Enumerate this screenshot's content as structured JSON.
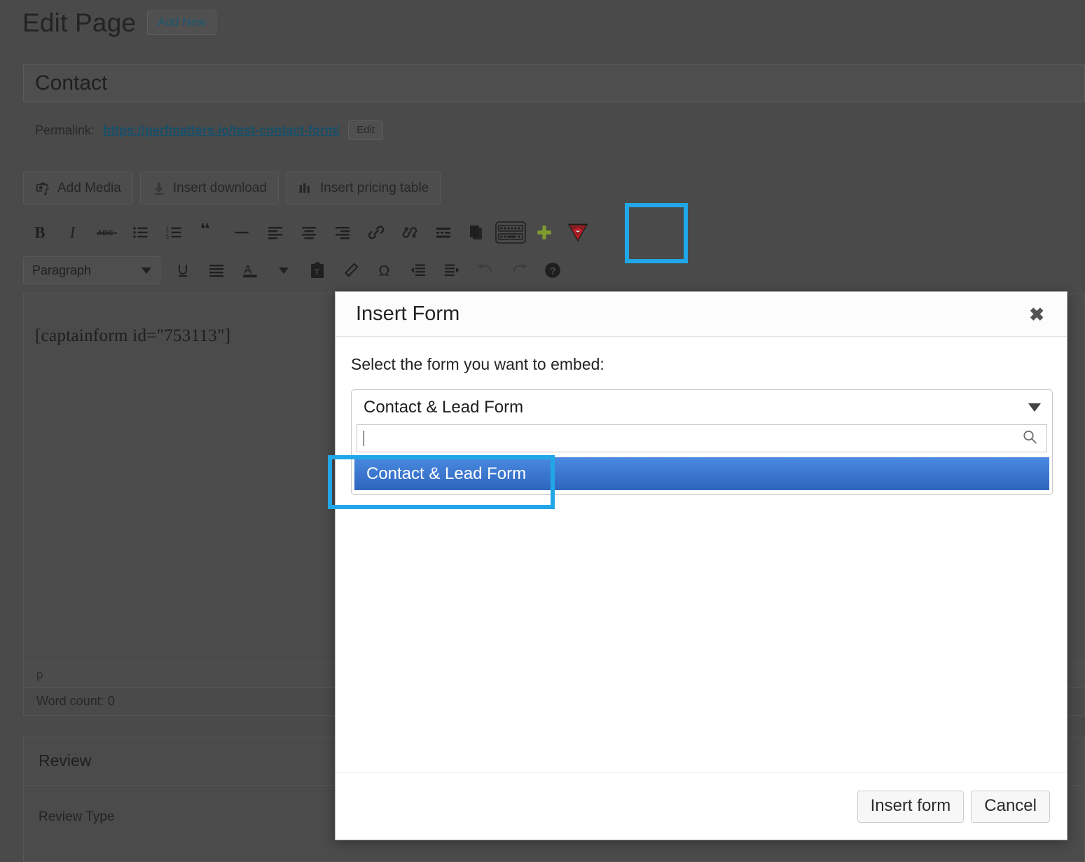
{
  "admin": {
    "page_title": "Edit Page",
    "add_new_label": "Add New",
    "post_title": "Contact",
    "permalink_label": "Permalink:",
    "permalink_url": "https://perfmatters.io/test-contact-form/",
    "permalink_edit_label": "Edit"
  },
  "media_buttons": [
    {
      "label": "Add Media",
      "icon": "add-media-icon"
    },
    {
      "label": "Insert download",
      "icon": "download-arrow-icon"
    },
    {
      "label": "Insert pricing table",
      "icon": "pricing-table-icon"
    }
  ],
  "toolbar_row1": [
    {
      "name": "bold",
      "glyph": "B"
    },
    {
      "name": "italic",
      "glyph": "I"
    },
    {
      "name": "strikethrough",
      "glyph": "ABC"
    },
    {
      "name": "bulleted-list",
      "glyph": ""
    },
    {
      "name": "numbered-list",
      "glyph": ""
    },
    {
      "name": "blockquote",
      "glyph": "“"
    },
    {
      "name": "horizontal-rule",
      "glyph": "—"
    },
    {
      "name": "align-left",
      "glyph": ""
    },
    {
      "name": "align-center",
      "glyph": ""
    },
    {
      "name": "align-right",
      "glyph": ""
    },
    {
      "name": "insert-link",
      "glyph": ""
    },
    {
      "name": "remove-link",
      "glyph": ""
    },
    {
      "name": "read-more-tag",
      "glyph": ""
    },
    {
      "name": "distraction-free",
      "glyph": ""
    },
    {
      "name": "toolbar-toggle",
      "glyph": ""
    },
    {
      "name": "add-shortcode",
      "glyph": "+"
    },
    {
      "name": "captainform-logo",
      "glyph": ""
    }
  ],
  "toolbar_row2": {
    "format_select_value": "Paragraph",
    "buttons": [
      {
        "name": "underline"
      },
      {
        "name": "justify"
      },
      {
        "name": "text-color"
      },
      {
        "name": "text-color-dropdown"
      },
      {
        "name": "paste-as-text"
      },
      {
        "name": "clear-formatting"
      },
      {
        "name": "special-character"
      },
      {
        "name": "decrease-indent"
      },
      {
        "name": "increase-indent"
      },
      {
        "name": "undo"
      },
      {
        "name": "redo"
      },
      {
        "name": "keyboard-shortcuts-help"
      }
    ]
  },
  "editor": {
    "content": "[captainform id=\"753113\"]",
    "path_indicator": "p",
    "word_count": "Word count: 0"
  },
  "review_box": {
    "title": "Review",
    "field_label": "Review Type"
  },
  "modal": {
    "title": "Insert Form",
    "close_icon": "close-icon",
    "instruction": "Select the form you want to embed:",
    "selected_form": "Contact & Lead Form",
    "dropdown_arrow_icon": "chevron-down-icon",
    "search_value": "",
    "search_placeholder": "",
    "search_icon": "search-icon",
    "options": [
      {
        "label": "Contact & Lead Form",
        "selected": true
      }
    ],
    "insert_label": "Insert form",
    "cancel_label": "Cancel"
  },
  "annotations": {
    "color": "#21a7e8",
    "items": [
      {
        "name": "captainform-toolbar-button-highlight"
      },
      {
        "name": "dropdown-option-highlight"
      }
    ]
  }
}
